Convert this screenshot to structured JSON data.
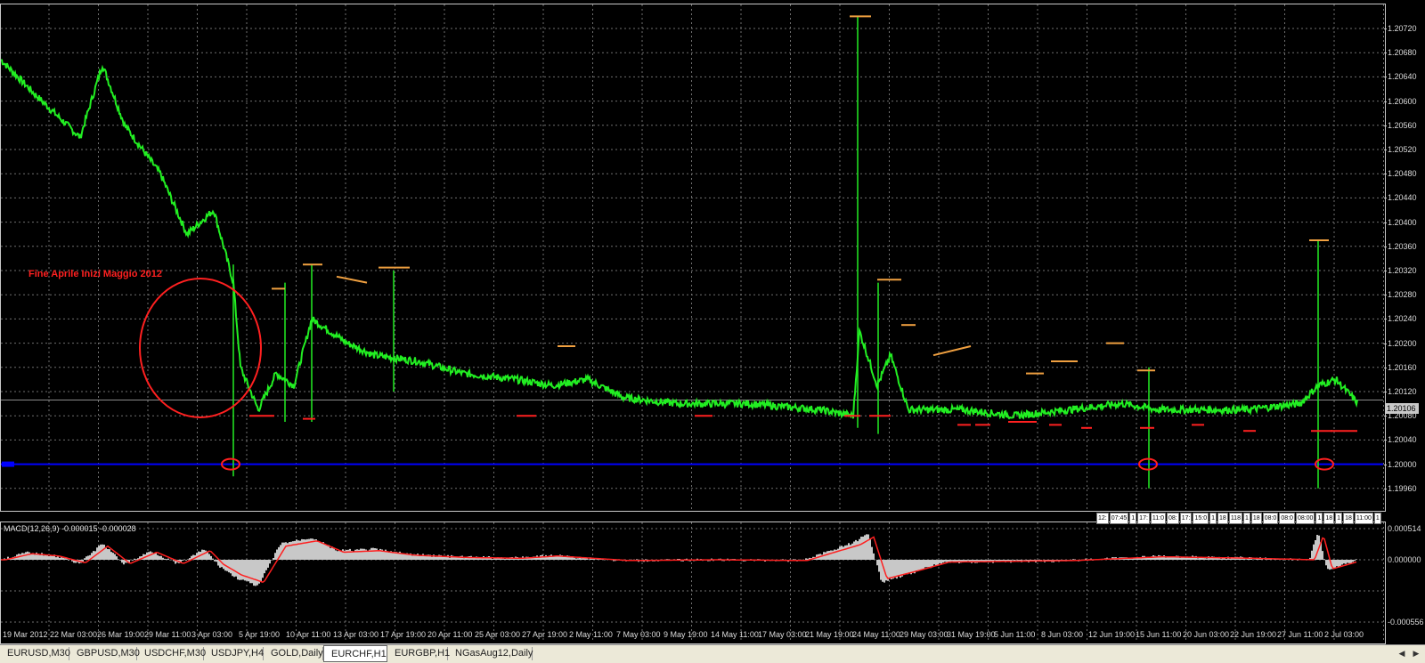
{
  "window": {
    "title": "EURCHF,H1"
  },
  "colors": {
    "background": "#000000",
    "grid": "#6f6f6f",
    "price_line": "#22ee22",
    "support_line": "#0000ff",
    "annotation": "#ff2020",
    "resistance_marks": "#f0a040",
    "support_marks": "#ff2020",
    "macd_signal": "#ff2020",
    "macd_histogram": "#c8c8c8"
  },
  "price_axis": {
    "labels": [
      "1.20720",
      "1.20680",
      "1.20640",
      "1.20600",
      "1.20560",
      "1.20520",
      "1.20480",
      "1.20440",
      "1.20400",
      "1.20360",
      "1.20320",
      "1.20280",
      "1.20240",
      "1.20200",
      "1.20160",
      "1.20120",
      "1.20080",
      "1.20040",
      "1.20000",
      "1.19960"
    ],
    "current_price": "1.20106"
  },
  "annotation": {
    "text": "Fine Aprile Inizi Maggio 2012"
  },
  "macd": {
    "label": "MACD(12,26,9) -0.000015 -0.000028",
    "axis_labels": [
      "0.000514",
      "0.000000",
      "-0.000556"
    ]
  },
  "time_axis": {
    "labels": [
      "19 Mar 2012",
      "22 Mar 03:00",
      "26 Mar 19:00",
      "29 Mar 11:00",
      "3 Apr 03:00",
      "5 Apr 19:00",
      "10 Apr 11:00",
      "13 Apr 03:00",
      "17 Apr 19:00",
      "20 Apr 11:00",
      "25 Apr 03:00",
      "27 Apr 19:00",
      "2 May 11:00",
      "7 May 03:00",
      "9 May 19:00",
      "14 May 11:00",
      "17 May 03:00",
      "21 May 19:00",
      "24 May 11:00",
      "29 May 03:00",
      "31 May 19:00",
      "5 Jun 11:00",
      "8 Jun 03:00",
      "12 Jun 19:00",
      "15 Jun 11:00",
      "20 Jun 03:00",
      "22 Jun 19:00",
      "27 Jun 11:00",
      "2 Jul 03:00"
    ]
  },
  "legend_strip": [
    "12:",
    "07:45",
    "1",
    "17:",
    "11:0",
    "08:",
    "17:",
    "15:0",
    "1",
    "18",
    "118",
    "1",
    "18",
    "08:0",
    "08:0",
    "08:00",
    "1",
    "18",
    "1",
    "18",
    "11:00",
    "1"
  ],
  "tabs": [
    {
      "label": "EURUSD,M30",
      "active": false
    },
    {
      "label": "GBPUSD,M30",
      "active": false
    },
    {
      "label": "USDCHF,M30",
      "active": false
    },
    {
      "label": "USDJPY,H4",
      "active": false
    },
    {
      "label": "GOLD,Daily",
      "active": false
    },
    {
      "label": "EURCHF,H1",
      "active": true
    },
    {
      "label": "EURGBP,H1",
      "active": false
    },
    {
      "label": "NGasAug12,Daily",
      "active": false
    }
  ],
  "scroll": {
    "left_icon": "arrow-left-icon",
    "right_icon": "arrow-right-icon",
    "left_glyph": "◀",
    "right_glyph": "▶"
  }
}
